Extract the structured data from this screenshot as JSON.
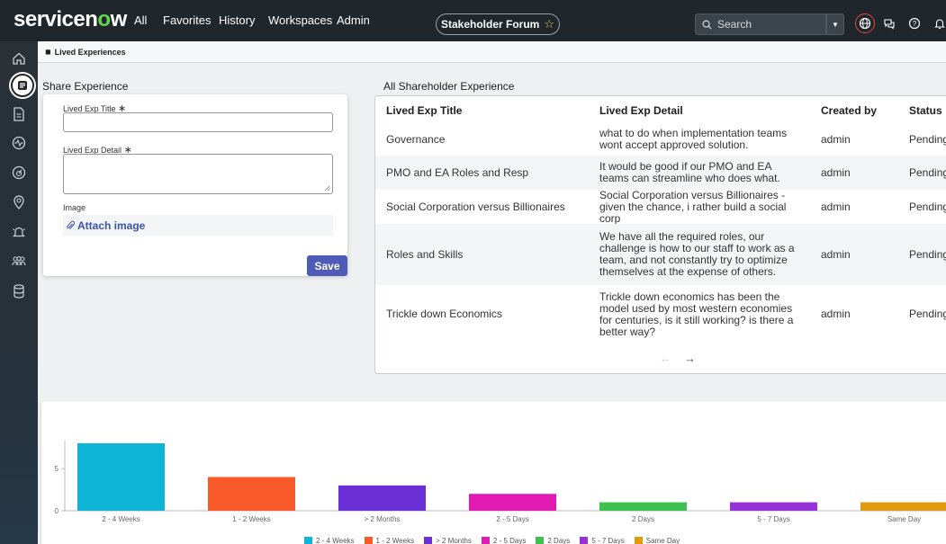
{
  "header": {
    "logo_text_a": "servicen",
    "logo_text_o": "o",
    "logo_text_b": "w",
    "nav": [
      "All",
      "Favorites",
      "History",
      "Workspaces",
      "Admin"
    ],
    "forum_label": "Stakeholder Forum",
    "star_icon": "☆",
    "search_placeholder": "Search",
    "dropdown_glyph": "▼",
    "globe_glyph": "⊕",
    "chat_glyph": "⩩",
    "help_glyph": "?",
    "bell_glyph": "♫"
  },
  "tab": {
    "label": "Lived Experiences",
    "icon": "◼"
  },
  "form": {
    "section_title": "Share Experience",
    "title_label": "Lived Exp Title",
    "detail_label": "Lived Exp Detail",
    "required_mark": "∗",
    "image_label": "Image",
    "attach_icon": "⌀",
    "attach_label": "Attach image",
    "save_label": "Save"
  },
  "table": {
    "section_title": "All Shareholder Experience",
    "columns": [
      "Lived Exp Title",
      "Lived Exp Detail",
      "Created by",
      "Status"
    ],
    "rows": [
      {
        "title": "Governance",
        "detail": "what to do when implementation teams wont accept approved solution.",
        "created_by": "admin",
        "status": "Pending"
      },
      {
        "title": "PMO and EA Roles and Resp",
        "detail": "It would be good if our PMO and EA teams can streamline who does what.",
        "created_by": "admin",
        "status": "Pending"
      },
      {
        "title": "Social Corporation versus Billionaires",
        "detail": "Social Corporation versus Billionaires - given the chance, i rather build a social corp",
        "created_by": "admin",
        "status": "Pending"
      },
      {
        "title": "Roles and Skills",
        "detail": "We have all the required roles, our challenge is how to our staff to work as a team, and not constantly try to optimize themselves at the expense of others.",
        "created_by": "admin",
        "status": "Pending"
      },
      {
        "title": "Trickle down Economics",
        "detail": "Trickle down economics has been the model used by most western economies for centuries, is it still working? is there a better way?",
        "created_by": "admin",
        "status": "Pending"
      }
    ],
    "prev_glyph": "←",
    "next_glyph": "→"
  },
  "chart_data": {
    "type": "bar",
    "categories": [
      "2 - 4 Weeks",
      "1 - 2 Weeks",
      "> 2 Months",
      "2 - 5 Days",
      "2 Days",
      "5 - 7 Days",
      "Same Day"
    ],
    "values": [
      8,
      4,
      3,
      2,
      1,
      1,
      1
    ],
    "colors": [
      "#0fb5d6",
      "#fa5a2a",
      "#6a2fd6",
      "#e01ab2",
      "#3dc14f",
      "#9732d8",
      "#e19a0b"
    ],
    "yticks": [
      0,
      5
    ],
    "ylim": [
      0,
      8
    ],
    "title": "",
    "xlabel": "",
    "ylabel": "",
    "legend": "bottom"
  },
  "rail_icons": [
    "home-icon",
    "list-icon",
    "document-icon",
    "activity-icon",
    "dashboard-icon",
    "map-pin-icon",
    "alert-icon",
    "people-icon",
    "database-icon"
  ]
}
